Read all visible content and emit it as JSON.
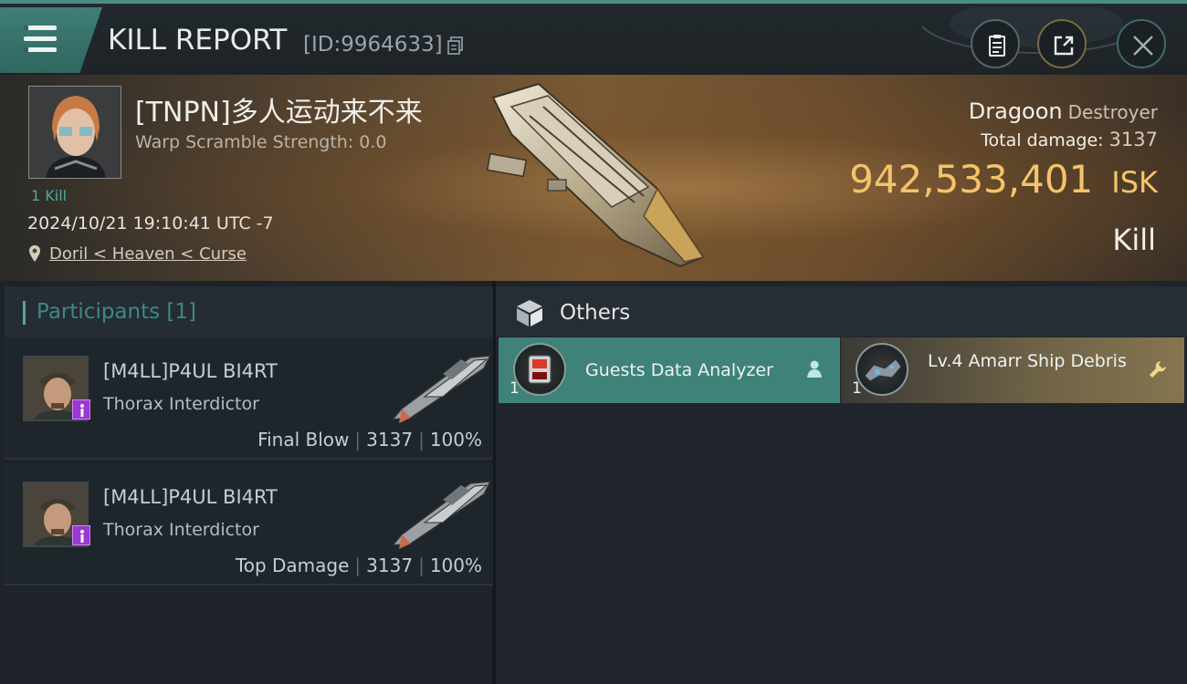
{
  "header": {
    "title": "KILL REPORT",
    "report_id": "[ID:9964633]",
    "icons": [
      "menu-icon",
      "copy-icon",
      "clipboard-icon",
      "share-icon",
      "close-icon"
    ]
  },
  "victim": {
    "name": "[TNPN]多人运动来不来",
    "warp_scramble": "Warp Scramble Strength: 0.0",
    "kills": "1 Kill",
    "datetime": "2024/10/21 19:10:41 UTC -7",
    "location": "Doril < Heaven < Curse",
    "ship_name": "Dragoon",
    "ship_class": "Destroyer",
    "total_damage_label": "Total damage:",
    "total_damage_value": "3137",
    "isk_value": "942,533,401",
    "isk_unit": "ISK",
    "result": "Kill"
  },
  "participants": {
    "header": "Participants [1]",
    "rows": [
      {
        "name": "[M4LL]P4UL BI4RT",
        "ship": "Thorax Interdictor",
        "role": "Final Blow",
        "damage": "3137",
        "percent": "100%"
      },
      {
        "name": "[M4LL]P4UL BI4RT",
        "ship": "Thorax Interdictor",
        "role": "Top Damage",
        "damage": "3137",
        "percent": "100%"
      }
    ]
  },
  "others": {
    "header": "Others",
    "items": [
      {
        "label": "Guests Data Analyzer",
        "qty": "1",
        "color": "#3e8279",
        "corner_icon": "person-icon"
      },
      {
        "label": "Lv.4 Amarr Ship Debris",
        "qty": "1",
        "color": "#857550",
        "corner_icon": "wrench-icon"
      }
    ]
  },
  "colors": {
    "accent_teal": "#4fa89c",
    "isk_gold": "#f3c46a",
    "badge_purple": "#9b37d2"
  }
}
